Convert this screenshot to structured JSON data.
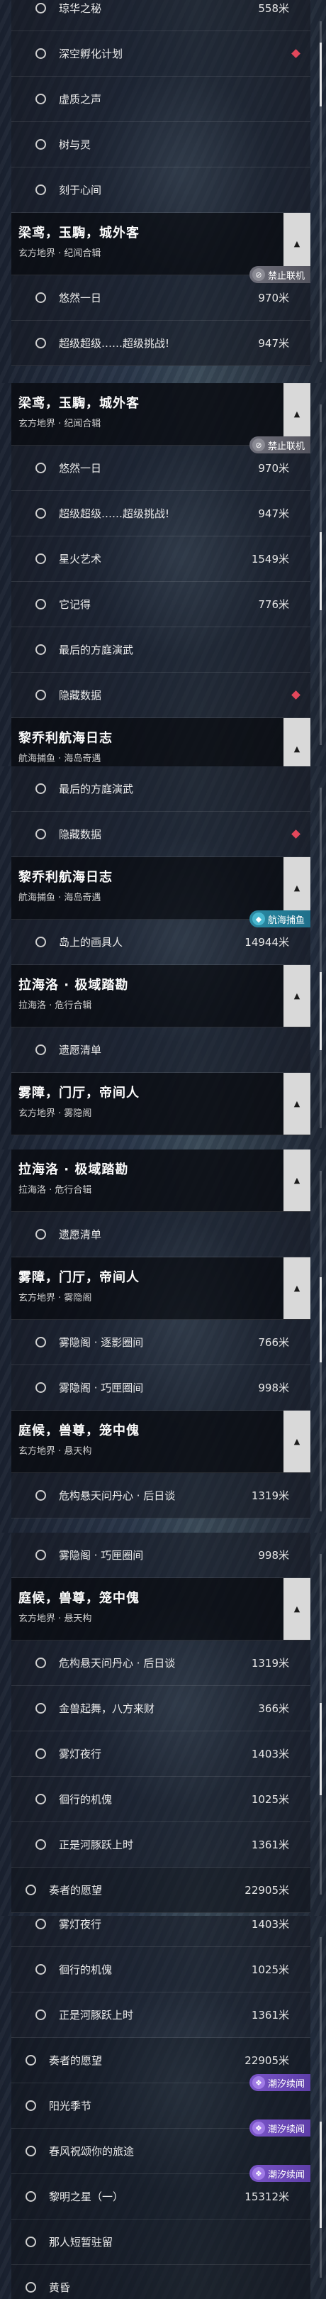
{
  "strips": [
    {
      "items": [
        {
          "kind": "sub",
          "label": "琼华之秘",
          "dist": "558米",
          "partial": true
        },
        {
          "kind": "sub",
          "label": "深空孵化计划",
          "diamond": true
        },
        {
          "kind": "sub",
          "label": "虚质之声"
        },
        {
          "kind": "sub",
          "label": "树与灵"
        },
        {
          "kind": "sub",
          "label": "刻于心间"
        },
        {
          "kind": "group",
          "title": "梁鸢，玉騊，城外客",
          "subtitle": "玄方地界 · 纪闻合辑"
        },
        {
          "kind": "sub",
          "label": "悠然一日",
          "dist": "970米",
          "badge": {
            "type": "ban",
            "icon": "⊘",
            "text": "禁止联机"
          }
        },
        {
          "kind": "sub",
          "label": "超级超级……超级挑战!",
          "dist": "947米"
        }
      ]
    },
    {
      "items": [
        {
          "kind": "group",
          "title": "梁鸢，玉騊，城外客",
          "subtitle": "玄方地界 · 纪闻合辑"
        },
        {
          "kind": "sub",
          "label": "悠然一日",
          "dist": "970米",
          "badge": {
            "type": "ban",
            "icon": "⊘",
            "text": "禁止联机"
          }
        },
        {
          "kind": "sub",
          "label": "超级超级……超级挑战!",
          "dist": "947米"
        },
        {
          "kind": "sub",
          "label": "星火艺术",
          "dist": "1549米"
        },
        {
          "kind": "sub",
          "label": "它记得",
          "dist": "776米"
        },
        {
          "kind": "sub",
          "label": "最后的方庭演武"
        },
        {
          "kind": "sub",
          "label": "隐藏数据",
          "diamond": true
        },
        {
          "kind": "group",
          "title": "黎乔利航海日志",
          "subtitle": "航海捕鱼 · 海岛奇遇"
        }
      ]
    },
    {
      "items": [
        {
          "kind": "sub",
          "label": "最后的方庭演武"
        },
        {
          "kind": "sub",
          "label": "隐藏数据",
          "diamond": true
        },
        {
          "kind": "group",
          "title": "黎乔利航海日志",
          "subtitle": "航海捕鱼 · 海岛奇遇"
        },
        {
          "kind": "sub",
          "label": "岛上的画具人",
          "dist": "14944米",
          "badge": {
            "type": "fish",
            "icon": "◆",
            "text": "航海捕鱼"
          }
        },
        {
          "kind": "group",
          "title": "拉海洛 · 极域踏勘",
          "subtitle": "拉海洛 · 危行合辑"
        },
        {
          "kind": "sub",
          "label": "遗愿清单"
        },
        {
          "kind": "group",
          "title": "雾障，门厅，帝间人",
          "subtitle": "玄方地界 · 雾隐阁"
        }
      ]
    },
    {
      "items": [
        {
          "kind": "group",
          "title": "拉海洛 · 极域踏勘",
          "subtitle": "拉海洛 · 危行合辑"
        },
        {
          "kind": "sub",
          "label": "遗愿清单"
        },
        {
          "kind": "group",
          "title": "雾障，门厅，帝间人",
          "subtitle": "玄方地界 · 雾隐阁"
        },
        {
          "kind": "sub",
          "label": "雾隐阁 · 逐影圈间",
          "dist": "766米"
        },
        {
          "kind": "sub",
          "label": "雾隐阁 · 巧匣圈间",
          "dist": "998米"
        },
        {
          "kind": "group",
          "title": "庭候，兽尊，笼中傀",
          "subtitle": "玄方地界 · 悬天构"
        },
        {
          "kind": "sub",
          "label": "危构悬天问丹心 · 后日谈",
          "dist": "1319米"
        }
      ]
    },
    {
      "items": [
        {
          "kind": "sub",
          "label": "雾隐阁 · 巧匣圈间",
          "dist": "998米"
        },
        {
          "kind": "group",
          "title": "庭候，兽尊，笼中傀",
          "subtitle": "玄方地界 · 悬天构"
        },
        {
          "kind": "sub",
          "label": "危构悬天问丹心 · 后日谈",
          "dist": "1319米"
        },
        {
          "kind": "sub",
          "label": "金兽起舞，八方来财",
          "dist": "366米"
        },
        {
          "kind": "sub",
          "label": "雾灯夜行",
          "dist": "1403米"
        },
        {
          "kind": "sub",
          "label": "徊行的机傀",
          "dist": "1025米"
        },
        {
          "kind": "sub",
          "label": "正是河豚跃上时",
          "dist": "1361米"
        },
        {
          "kind": "top",
          "label": "奏者的愿望",
          "dist": "22905米"
        }
      ]
    },
    {
      "items": [
        {
          "kind": "sub",
          "label": "雾灯夜行",
          "dist": "1403米",
          "partial": true
        },
        {
          "kind": "sub",
          "label": "徊行的机傀",
          "dist": "1025米"
        },
        {
          "kind": "sub",
          "label": "正是河豚跃上时",
          "dist": "1361米"
        },
        {
          "kind": "top",
          "label": "奏者的愿望",
          "dist": "22905米"
        },
        {
          "kind": "top",
          "label": "阳光季节",
          "badge": {
            "type": "tide",
            "icon": "❖",
            "text": "潮汐续闻"
          }
        },
        {
          "kind": "top",
          "label": "春风祝颂你的旅途",
          "badge": {
            "type": "tide",
            "icon": "❖",
            "text": "潮汐续闻"
          }
        },
        {
          "kind": "top",
          "label": "黎明之星（一）",
          "dist": "15312米",
          "badge": {
            "type": "tide",
            "icon": "❖",
            "text": "潮汐续闻"
          }
        },
        {
          "kind": "top",
          "label": "那人短暂驻留"
        },
        {
          "kind": "top",
          "label": "黄昏",
          "partial": true
        }
      ]
    }
  ]
}
